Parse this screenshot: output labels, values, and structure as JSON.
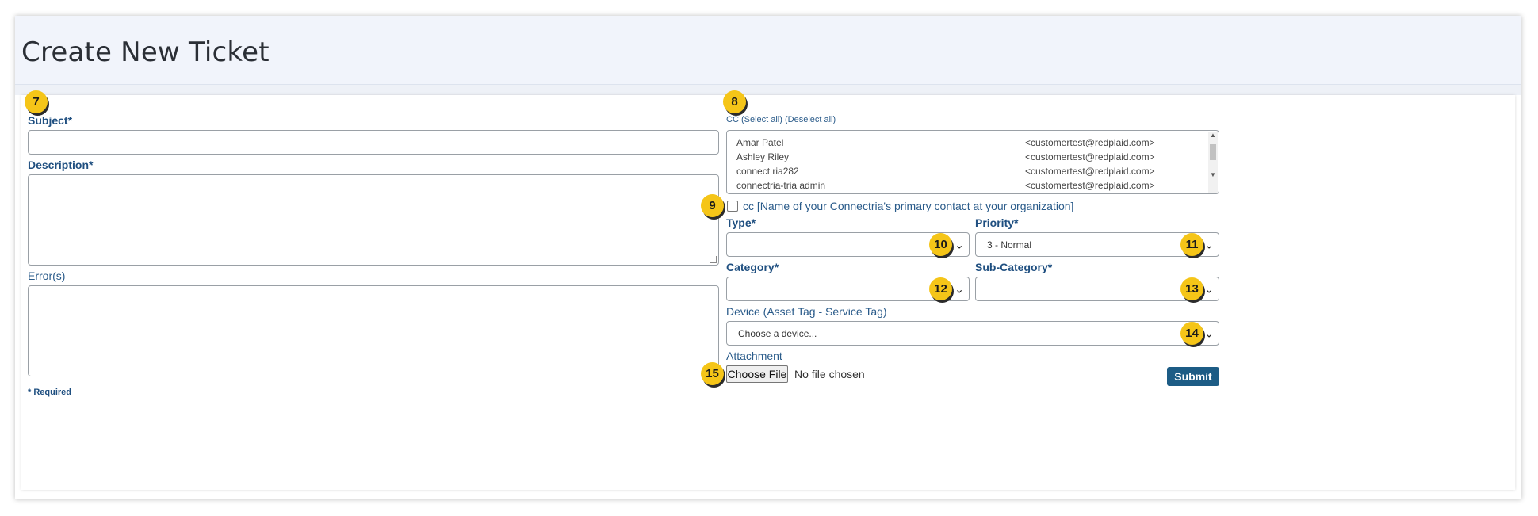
{
  "page": {
    "title": "Create New Ticket"
  },
  "form": {
    "subject_label": "Subject*",
    "description_label": "Description*",
    "errors_label": "Error(s)",
    "required_note": "* Required",
    "cc_label": "CC",
    "cc_select_all": "(Select all)",
    "cc_deselect_all": "(Deselect all)",
    "cc_contacts": [
      {
        "name": "Amar Patel",
        "email": "<customertest@redplaid.com>"
      },
      {
        "name": "Ashley Riley",
        "email": "<customertest@redplaid.com>"
      },
      {
        "name": "connect ria282",
        "email": "<customertest@redplaid.com>"
      },
      {
        "name": "connectria-tria admin",
        "email": "<customertest@redplaid.com>"
      }
    ],
    "cc_primary_checkbox_label": "cc [Name of your Connectria's primary contact at your organization]",
    "type_label": "Type*",
    "type_value": "",
    "priority_label": "Priority*",
    "priority_value": "3 - Normal",
    "category_label": "Category*",
    "category_value": "",
    "subcategory_label": "Sub-Category*",
    "subcategory_value": "",
    "device_label": "Device (Asset Tag - Service Tag)",
    "device_placeholder": "Choose a device...",
    "attachment_label": "Attachment",
    "choose_file_label": "Choose File",
    "no_file_text": "No file chosen",
    "submit_label": "Submit"
  },
  "annotations": {
    "b7": "7",
    "b8": "8",
    "b9": "9",
    "b10": "10",
    "b11": "11",
    "b12": "12",
    "b13": "13",
    "b14": "14",
    "b15": "15"
  },
  "icons": {
    "select_chevron": "chevron-down-icon"
  },
  "colors": {
    "label_blue": "#1f4f80",
    "badge_yellow": "#f5c518",
    "submit_blue": "#1d5c85"
  }
}
